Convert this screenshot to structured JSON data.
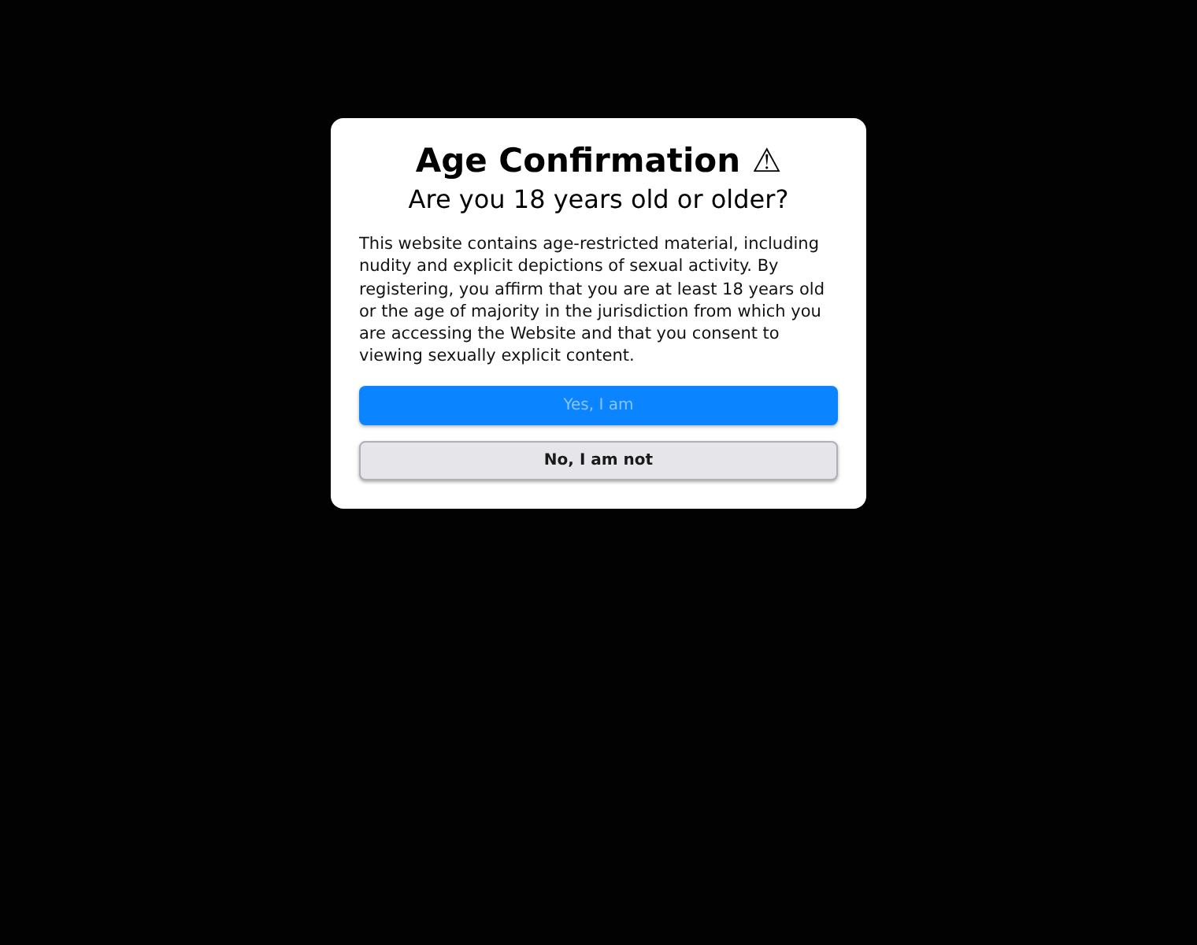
{
  "dialog": {
    "title": "Age Confirmation ⚠",
    "subtitle": "Are you 18 years old or older?",
    "message": "This website contains age-restricted material, including nudity and explicit depictions of sexual activity. By registering, you affirm that you are at least 18 years old or the age of majority in the jurisdiction from which you are accessing the Website and that you consent to viewing sexually explicit content.",
    "buttons": [
      {
        "label": "Yes, I am",
        "kind": "primary"
      },
      {
        "label": "No, I am not",
        "kind": "secondary"
      }
    ]
  }
}
